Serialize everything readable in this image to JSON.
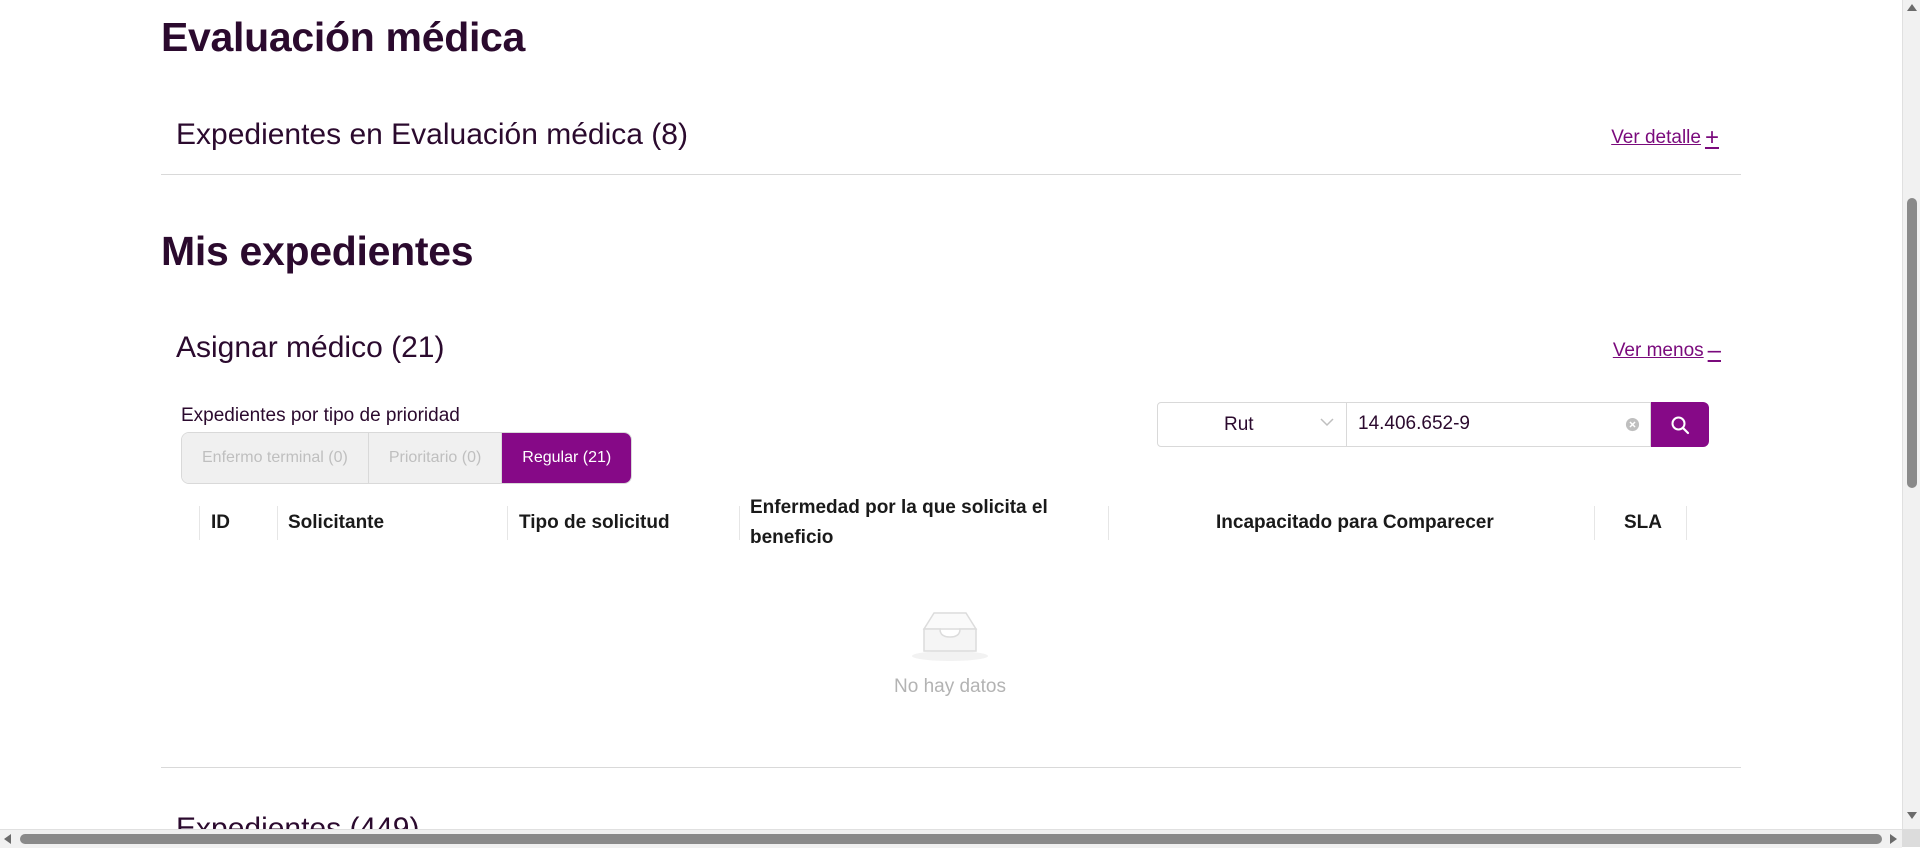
{
  "sections": {
    "evaluacion": {
      "title": "Evaluación médica",
      "panel_title": "Expedientes en Evaluación médica (8)",
      "toggle_label": "Ver detalle",
      "toggle_symbol": "+"
    },
    "mis_expedientes": {
      "title": "Mis expedientes",
      "panel_title": "Asignar médico (21)",
      "toggle_label": "Ver menos",
      "toggle_symbol": "–",
      "priority_label": "Expedientes por tipo de prioridad",
      "priority_tabs": [
        {
          "label": "Enfermo terminal (0)",
          "state": "disabled"
        },
        {
          "label": "Prioritario (0)",
          "state": "disabled"
        },
        {
          "label": "Regular (21)",
          "state": "selected"
        }
      ],
      "search": {
        "filter_selected": "Rut",
        "value": "14.406.652-9",
        "clear_icon": "close-circle-icon",
        "search_icon": "search-icon"
      },
      "table": {
        "columns": [
          "ID",
          "Solicitante",
          "Tipo de solicitud",
          "Enfermedad por la que solicita el beneficio",
          "Incapacitado para Comparecer",
          "SLA"
        ],
        "rows": [],
        "empty_text": "No hay datos",
        "empty_icon": "inbox-icon"
      }
    },
    "next_panel": {
      "title_partial": "Expedientes (449)"
    }
  },
  "colors": {
    "brand": "#860987",
    "heading": "#2b0a2e",
    "link": "#7a0a7c",
    "muted": "#b3b3b3"
  }
}
